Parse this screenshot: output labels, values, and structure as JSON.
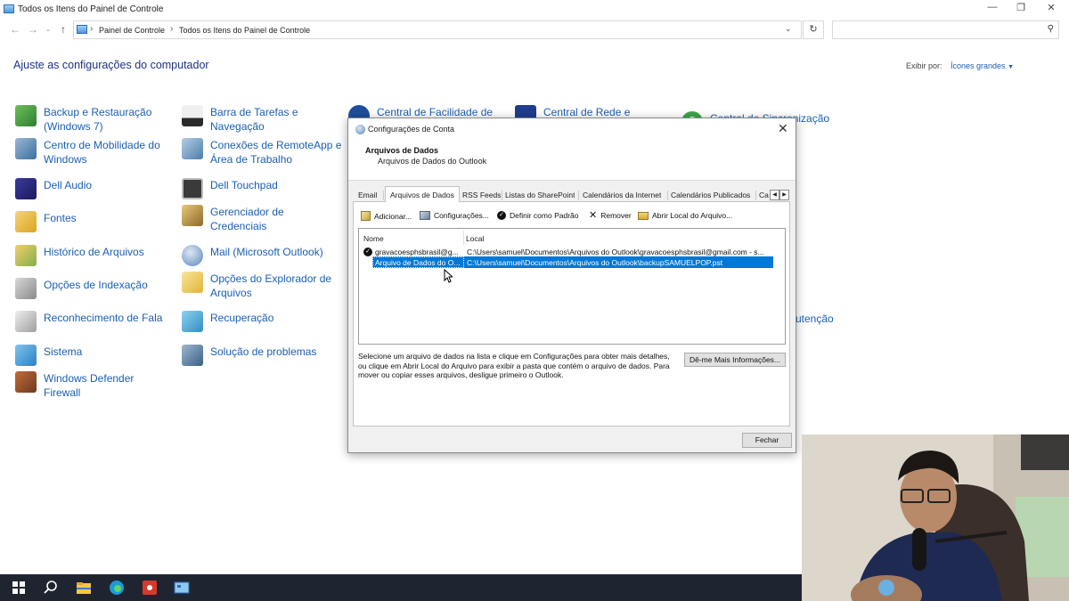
{
  "window": {
    "title": "Todos os Itens do Painel de Controle",
    "controls": {
      "minimize": "—",
      "maximize": "❐",
      "close": "✕"
    }
  },
  "address": {
    "crumbs": [
      "Painel de Controle",
      "Todos os Itens do Painel de Controle"
    ],
    "search_placeholder": ""
  },
  "heading": "Ajuste as configurações do computador",
  "view_by": {
    "label": "Exibir por:",
    "value": "Ícones grandes"
  },
  "items": {
    "col1": [
      {
        "label": "Backup e Restauração\n(Windows 7)",
        "icon": "backup-icon"
      },
      {
        "label": "Centro de Mobilidade do\nWindows",
        "icon": "mobility-icon"
      },
      {
        "label": "Dell Audio",
        "icon": "dell-audio-icon"
      },
      {
        "label": "Fontes",
        "icon": "fonts-icon"
      },
      {
        "label": "Histórico de Arquivos",
        "icon": "file-history-icon"
      },
      {
        "label": "Opções de Indexação",
        "icon": "indexing-icon"
      },
      {
        "label": "Reconhecimento de Fala",
        "icon": "microphone-icon"
      },
      {
        "label": "Sistema",
        "icon": "system-icon"
      },
      {
        "label": "Windows Defender\nFirewall",
        "icon": "firewall-icon"
      }
    ],
    "col2": [
      {
        "label": "Barra de Tarefas e\nNavegação",
        "icon": "taskbar-icon"
      },
      {
        "label": "Conexões de RemoteApp e\nÁrea de Trabalho",
        "icon": "remoteapp-icon"
      },
      {
        "label": "Dell Touchpad",
        "icon": "touchpad-icon"
      },
      {
        "label": "Gerenciador de\nCredenciais",
        "icon": "credentials-icon"
      },
      {
        "label": "Mail (Microsoft Outlook)",
        "icon": "mail-icon"
      },
      {
        "label": "Opções do Explorador de\nArquivos",
        "icon": "folder-options-icon"
      },
      {
        "label": "Recuperação",
        "icon": "recovery-icon"
      },
      {
        "label": "Solução de problemas",
        "icon": "troubleshooting-icon"
      }
    ],
    "col3_partial": {
      "label": "Central de Facilidade de",
      "icon": "ease-of-access-icon"
    },
    "col4_partial": {
      "label": "Central de Rede e",
      "icon": "network-icon"
    },
    "col5_partial": {
      "label": "Central de Sincronização",
      "icon": "sync-icon"
    },
    "col5_partial_2": "utenção"
  },
  "dialog": {
    "title": "Configurações de Conta",
    "section_title": "Arquivos de Dados",
    "section_subtitle": "Arquivos de Dados do Outlook",
    "tabs": [
      "Email",
      "Arquivos de Dados",
      "RSS Feeds",
      "Listas do SharePoint",
      "Calendários da Internet",
      "Calendários Publicados",
      "Ca"
    ],
    "active_tab": "Arquivos de Dados",
    "toolbar": {
      "add": "Adicionar...",
      "settings": "Configurações...",
      "set_default": "Definir como Padrão",
      "remove": "Remover",
      "open_location": "Abrir Local do Arquivo..."
    },
    "columns": {
      "name": "Nome",
      "location": "Local"
    },
    "rows": [
      {
        "name": "gravacoesphsbrasil@g...",
        "location": "C:\\Users\\samuel\\Documentos\\Arquivos do Outlook\\gravacoesphsbrasil@gmail.com - s...",
        "default": true,
        "selected": false
      },
      {
        "name": "Arquivo de Dados do O...",
        "location": "C:\\Users\\samuel\\Documentos\\Arquivos do Outlook\\backupSAMUELPOP.pst",
        "default": false,
        "selected": true
      }
    ],
    "help_text": "Selecione um arquivo de dados na lista e clique em Configurações para obter mais detalhes, ou clique em Abrir Local do Arquivo para exibir a pasta que contém o arquivo de dados. Para mover ou copiar esses arquivos, desligue primeiro o Outlook.",
    "more_info_button": "Dê-me Mais Informações...",
    "close_button": "Fechar"
  },
  "taskbar": {
    "apps": [
      "start-icon",
      "search-icon",
      "file-explorer-icon",
      "edge-icon",
      "recorder-icon",
      "control-panel-icon"
    ]
  },
  "colors": {
    "accent": "#0078d7",
    "link": "#1a5fb4",
    "heading": "#1e3287",
    "taskbar": "#1f2530"
  }
}
